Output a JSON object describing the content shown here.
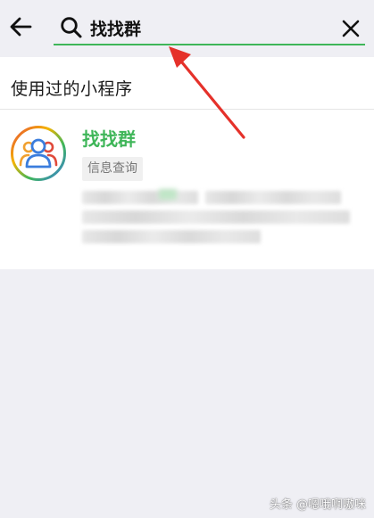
{
  "search": {
    "query": "找找群",
    "accent_color": "#3fb659"
  },
  "icons": {
    "back": "arrow-left-icon",
    "search": "magnifier-icon",
    "clear": "close-icon",
    "avatar": "group-people-icon"
  },
  "section": {
    "title": "使用过的小程序"
  },
  "results": [
    {
      "name": "找找群",
      "tag": "信息查询",
      "name_color": "#3fb659"
    }
  ],
  "watermark": {
    "text": "头条 @嗯哦啊嗷咪"
  }
}
